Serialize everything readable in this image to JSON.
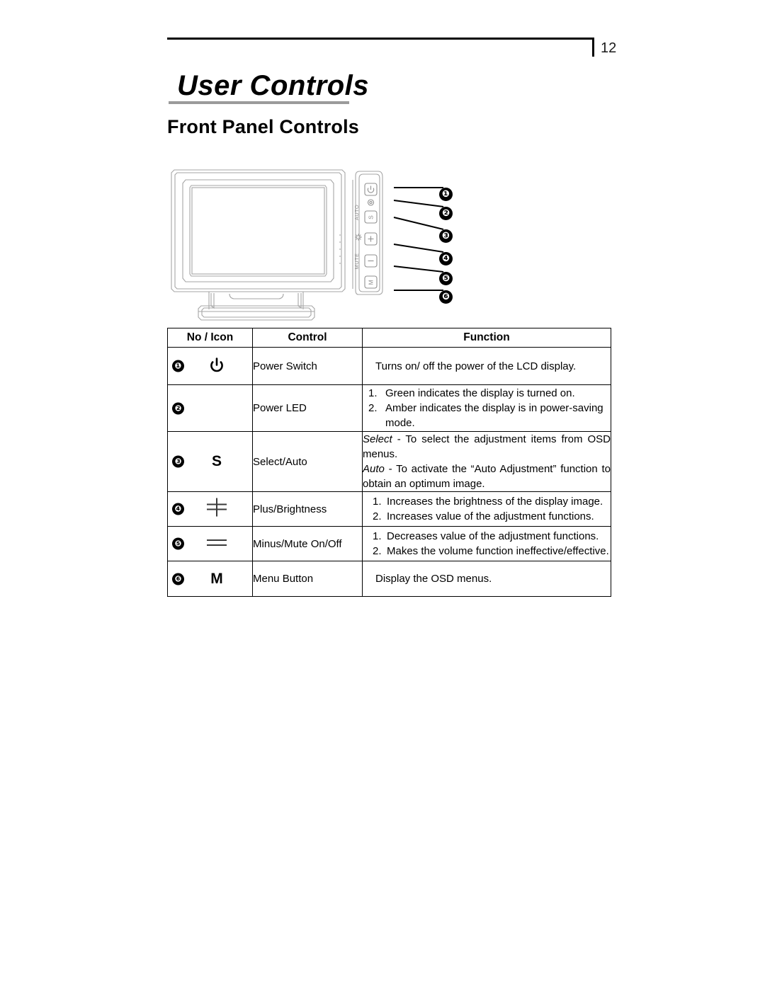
{
  "page": {
    "number": "12",
    "chapter_title": "User Controls",
    "section_title": "Front Panel Controls"
  },
  "diagram": {
    "name": "lcd-monitor-front-panel-diagram",
    "side_panel_labels": [
      "AUTO",
      "brightness-icon",
      "MUTE"
    ],
    "button_glyphs": [
      "power",
      "led-dot",
      "S",
      "+",
      "-",
      "M"
    ],
    "callouts": [
      {
        "num": "❶"
      },
      {
        "num": "❷"
      },
      {
        "num": "❸"
      },
      {
        "num": "❹"
      },
      {
        "num": "❺"
      },
      {
        "num": "❻"
      }
    ]
  },
  "table": {
    "headers": {
      "icon": "No / Icon",
      "control": "Control",
      "function": "Function"
    },
    "rows": [
      {
        "num": "❶",
        "glyph": "⏻",
        "glyph_name": "power-icon",
        "control": "Power Switch",
        "function_type": "plain",
        "function": "Turns on/ off the power of the LCD display."
      },
      {
        "num": "❷",
        "glyph": "",
        "glyph_name": "none",
        "control": "Power LED",
        "function_type": "list",
        "items": [
          {
            "n": "1.",
            "text": "Green indicates the display is turned on."
          },
          {
            "n": "2.",
            "text": "Amber indicates the display is in power-saving mode."
          }
        ]
      },
      {
        "num": "❸",
        "glyph": "S",
        "glyph_name": "select-auto-icon",
        "control": "Select/Auto",
        "function_type": "rich",
        "lines": [
          {
            "lead": "Select",
            "rest": " - To select the adjustment items from OSD menus."
          },
          {
            "lead": "Auto",
            "rest": " - To activate the “Auto Adjustment” function to obtain an optimum image."
          }
        ]
      },
      {
        "num": "❹",
        "glyph": "plus",
        "glyph_name": "plus-brightness-icon",
        "control": "Plus/Brightness",
        "function_type": "list",
        "items": [
          {
            "n": "1.",
            "text": "Increases the brightness of the display image."
          },
          {
            "n": "2.",
            "text": "Increases value of the adjustment functions."
          }
        ]
      },
      {
        "num": "❺",
        "glyph": "equals",
        "glyph_name": "minus-mute-icon",
        "control": "Minus/Mute On/Off",
        "function_type": "list",
        "items": [
          {
            "n": "1.",
            "text": "Decreases value of the adjustment functions."
          },
          {
            "n": "2.",
            "text": "Makes the volume function ineffective/effective."
          }
        ]
      },
      {
        "num": "❻",
        "glyph": "M",
        "glyph_name": "menu-icon",
        "control": "Menu Button",
        "function_type": "plain",
        "function": "Display the OSD menus."
      }
    ]
  }
}
